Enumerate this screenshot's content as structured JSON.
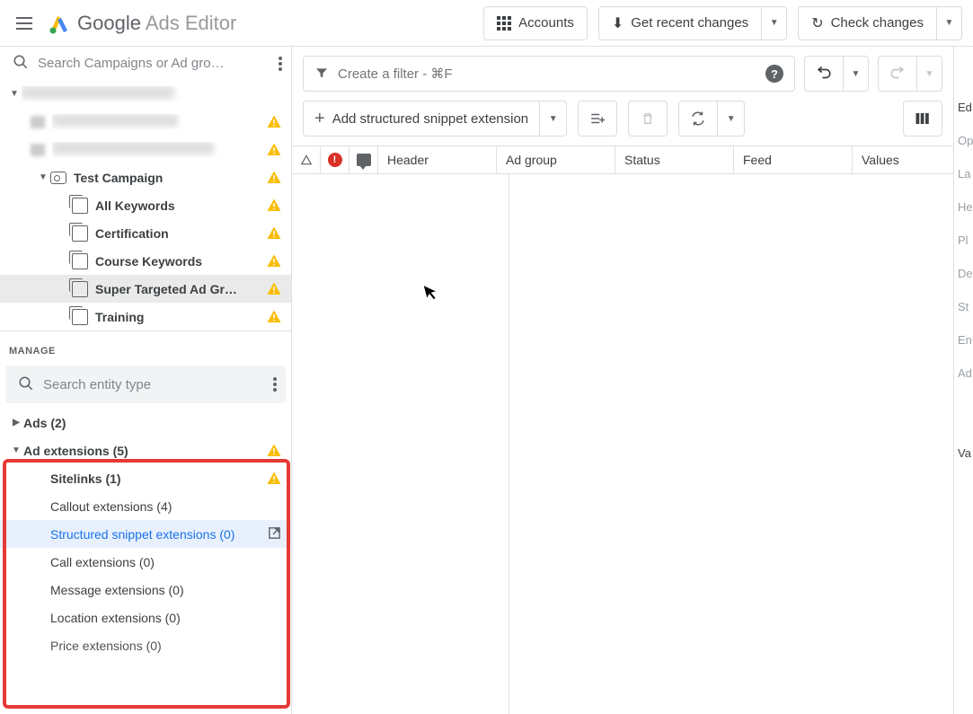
{
  "app": {
    "title_main": "Google",
    "title_sub": "Ads Editor"
  },
  "topbar": {
    "accounts": "Accounts",
    "get_recent": "Get recent changes",
    "check_changes": "Check changes"
  },
  "sidebar": {
    "search_placeholder": "Search Campaigns or Ad gro…",
    "campaign": "Test Campaign",
    "adgroups": [
      "All Keywords",
      "Certification",
      "Course Keywords",
      "Super Targeted Ad Gr…",
      "Training"
    ]
  },
  "manage": {
    "header": "MANAGE",
    "search_placeholder": "Search entity type",
    "ads": "Ads (2)",
    "ad_extensions": "Ad extensions (5)",
    "items": [
      "Sitelinks (1)",
      "Callout extensions (4)",
      "Structured snippet extensions (0)",
      "Call extensions (0)",
      "Message extensions (0)",
      "Location extensions (0)",
      "Price extensions (0)"
    ]
  },
  "main": {
    "filter_placeholder": "Create a filter - ⌘F",
    "add_btn": "Add structured snippet extension",
    "columns": {
      "header": "Header",
      "adgroup": "Ad group",
      "status": "Status",
      "feed": "Feed",
      "values": "Values"
    }
  },
  "right": {
    "edit": "Ed",
    "op": "Op",
    "la": "La",
    "he": "He",
    "pl": "Pl",
    "de": "De",
    "st": "St",
    "en": "En",
    "ad": "Ad",
    "va": "Va"
  }
}
